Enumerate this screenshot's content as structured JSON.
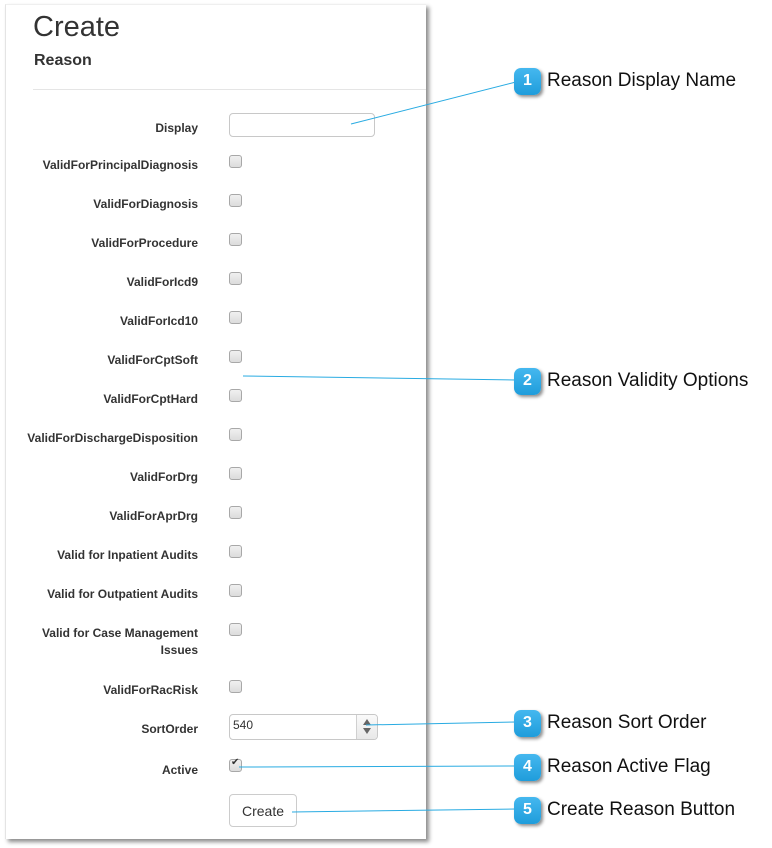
{
  "page": {
    "title": "Create",
    "subtitle": "Reason"
  },
  "form": {
    "display": {
      "label": "Display",
      "value": "",
      "placeholder": ""
    },
    "checkboxes": [
      {
        "label": "ValidForPrincipalDiagnosis",
        "checked": false
      },
      {
        "label": "ValidForDiagnosis",
        "checked": false
      },
      {
        "label": "ValidForProcedure",
        "checked": false
      },
      {
        "label": "ValidForIcd9",
        "checked": false
      },
      {
        "label": "ValidForIcd10",
        "checked": false
      },
      {
        "label": "ValidForCptSoft",
        "checked": false
      },
      {
        "label": "ValidForCptHard",
        "checked": false
      },
      {
        "label": "ValidForDischargeDisposition",
        "checked": false
      },
      {
        "label": "ValidForDrg",
        "checked": false
      },
      {
        "label": "ValidForAprDrg",
        "checked": false
      },
      {
        "label": "Valid for Inpatient Audits",
        "checked": false
      },
      {
        "label": "Valid for Outpatient Audits",
        "checked": false
      },
      {
        "label": "Valid for Case Management Issues",
        "checked": false
      },
      {
        "label": "ValidForRacRisk",
        "checked": false
      }
    ],
    "sort_order": {
      "label": "SortOrder",
      "value": "540"
    },
    "active": {
      "label": "Active",
      "checked": true
    },
    "submit_label": "Create"
  },
  "callouts": [
    {
      "number": "1",
      "text": "Reason Display Name"
    },
    {
      "number": "2",
      "text": "Reason Validity Options"
    },
    {
      "number": "3",
      "text": "Reason Sort Order"
    },
    {
      "number": "4",
      "text": "Reason Active Flag"
    },
    {
      "number": "5",
      "text": "Create Reason Button"
    }
  ],
  "colors": {
    "callout_accent": "#29abe2",
    "connector_line": "#29abe2"
  }
}
